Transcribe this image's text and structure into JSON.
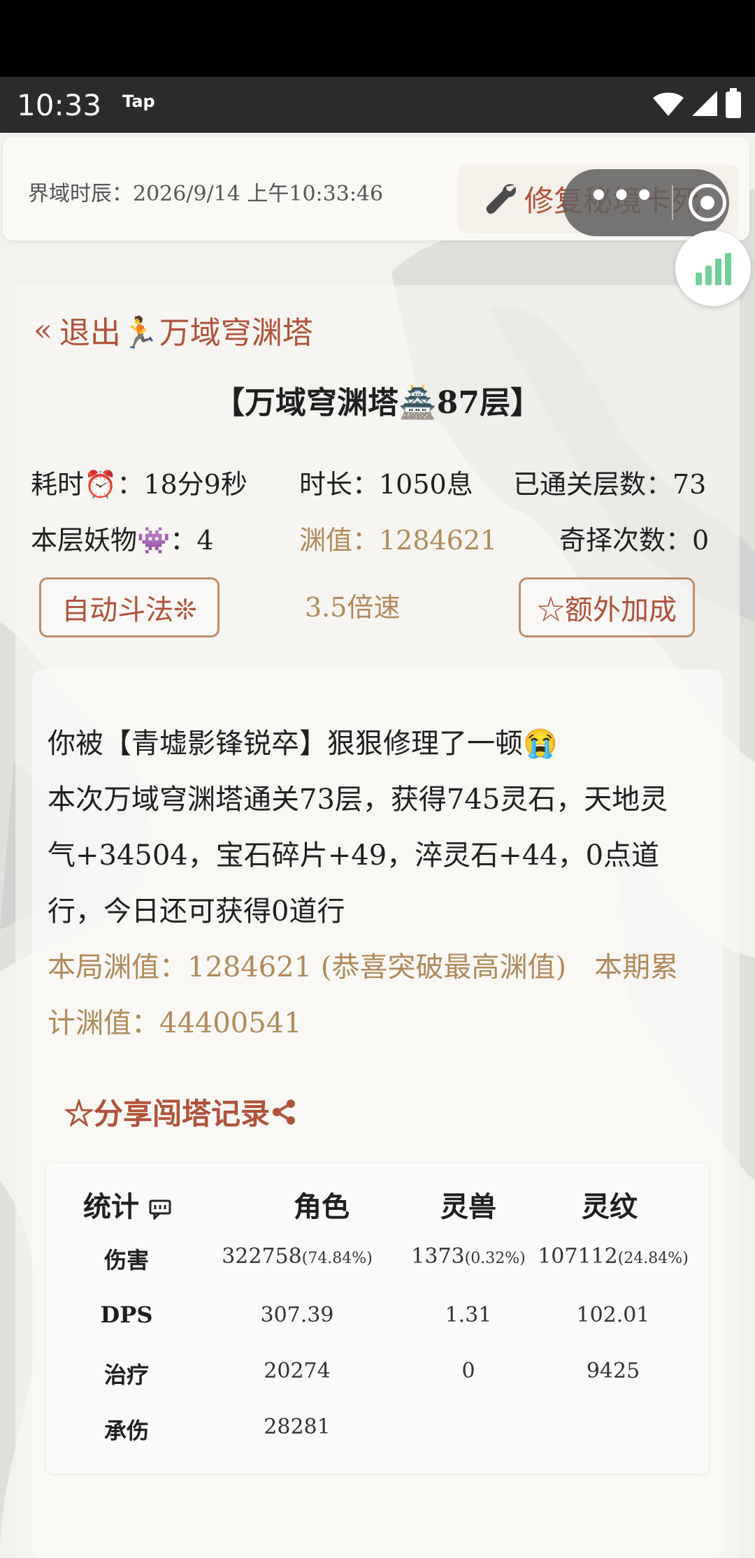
{
  "status_bar": {
    "time": "10:33",
    "app_badge": "Tap"
  },
  "header": {
    "clock": "界域时辰：2026/9/14 上午10:33:46",
    "repair_label": "修复秘境卡死",
    "capsule_dots": "•••"
  },
  "nav": {
    "exit_label": "退出🏃万域穹渊塔"
  },
  "floor": {
    "title": "【万域穹渊塔🏯87层】"
  },
  "stats": {
    "elapsed": "耗时⏰：18分9秒",
    "duration": "时长：1050息",
    "cleared": "已通关层数：73",
    "monsters": "本层妖物👾：4",
    "abyss_value": "渊值：1284621",
    "choices": "奇择次数：0"
  },
  "controls": {
    "auto_battle": "自动斗法❊",
    "speed": "3.5倍速",
    "extra_bonus": "☆额外加成"
  },
  "result": {
    "line1": "你被【青墟影锋锐卒】狠狠修理了一顿😭",
    "line2": "本次万域穹渊塔通关73层，获得745灵石，天地灵",
    "line3": "气+34504，宝石碎片+49，淬灵石+44，0点道",
    "line4": "行，今日还可获得0道行",
    "line5": "本局渊值：1284621 (恭喜突破最高渊值)　本期累",
    "line6": "计渊值：44400541"
  },
  "share_label": "☆分享闯塔记录",
  "table": {
    "headers": [
      "统计",
      "角色",
      "灵兽",
      "灵纹"
    ],
    "rows": [
      {
        "label": "伤害",
        "cells": [
          {
            "v": "322758",
            "p": "(74.84%)"
          },
          {
            "v": "1373",
            "p": "(0.32%)"
          },
          {
            "v": "107112",
            "p": "(24.84%)"
          }
        ]
      },
      {
        "label": "DPS",
        "cells": [
          {
            "v": "307.39",
            "p": ""
          },
          {
            "v": "1.31",
            "p": ""
          },
          {
            "v": "102.01",
            "p": ""
          }
        ]
      },
      {
        "label": "治疗",
        "cells": [
          {
            "v": "20274",
            "p": ""
          },
          {
            "v": "0",
            "p": ""
          },
          {
            "v": "9425",
            "p": ""
          }
        ]
      },
      {
        "label": "承伤",
        "cells": [
          {
            "v": "28281",
            "p": ""
          },
          {
            "v": "",
            "p": ""
          },
          {
            "v": "",
            "p": ""
          }
        ]
      }
    ]
  },
  "colors": {
    "accent": "#b0523a",
    "gold": "#b08a5a",
    "border": "#c08d6a"
  }
}
